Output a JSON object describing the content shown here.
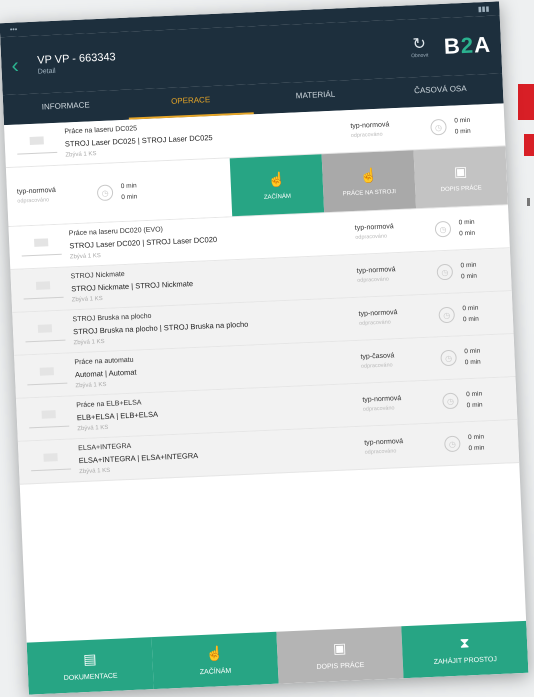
{
  "header": {
    "title": "VP VP - 663343",
    "subtitle": "Detail",
    "sync_label": "Obnovit",
    "logo_b": "B",
    "logo_2": "2",
    "logo_a": "A"
  },
  "tabs": [
    {
      "label": "INFORMACE"
    },
    {
      "label": "OPERACE"
    },
    {
      "label": "MATERIÁL"
    },
    {
      "label": "ČASOVÁ OSA"
    }
  ],
  "operations": [
    {
      "name": "Práce na laseru DC025",
      "desc": "STROJ Laser DC025 | STROJ Laser DC025",
      "qty": "Zbývá 1 KS",
      "norm": "typ-normová",
      "norm_sub": "odpracováno",
      "t1": "0 min",
      "t2": "0 min"
    },
    {
      "name": "Práce na laseru DC020 (EVO)",
      "desc": "STROJ Laser DC020 | STROJ Laser DC020",
      "qty": "Zbývá 1 KS",
      "norm": "typ-normová",
      "norm_sub": "odpracováno",
      "t1": "0 min",
      "t2": "0 min"
    },
    {
      "name": "STROJ Nickmate",
      "desc": "STROJ Nickmate | STROJ Nickmate",
      "qty": "Zbývá 1 KS",
      "norm": "typ-normová",
      "norm_sub": "odpracováno",
      "t1": "0 min",
      "t2": "0 min"
    },
    {
      "name": "STROJ Bruska na plocho",
      "desc": "STROJ Bruska na plocho | STROJ Bruska na plocho",
      "qty": "Zbývá 1 KS",
      "norm": "typ-normová",
      "norm_sub": "odpracováno",
      "t1": "0 min",
      "t2": "0 min"
    },
    {
      "name": "Práce na automatu",
      "desc": "Automat | Automat",
      "qty": "Zbývá 1 KS",
      "norm": "typ-časová",
      "norm_sub": "odpracováno",
      "t1": "0 min",
      "t2": "0 min"
    },
    {
      "name": "Práce na ELB+ELSA",
      "desc": "ELB+ELSA | ELB+ELSA",
      "qty": "Zbývá 1 KS",
      "norm": "typ-normová",
      "norm_sub": "odpracováno",
      "t1": "0 min",
      "t2": "0 min"
    },
    {
      "name": "ELSA+INTEGRA",
      "desc": "ELSA+INTEGRA | ELSA+INTEGRA",
      "qty": "Zbývá 1 KS",
      "norm": "typ-normová",
      "norm_sub": "odpracováno",
      "t1": "0 min",
      "t2": "0 min"
    }
  ],
  "action_row": {
    "norm": "typ-normová",
    "norm_sub": "odpracováno",
    "t1": "0 min",
    "t2": "0 min",
    "btn_start": "ZAČÍNÁM",
    "btn_machine": "PRÁCE NA STROJI",
    "btn_done": "DOPIS PRÁCE"
  },
  "footer": [
    {
      "label": "DOKUMENTACE"
    },
    {
      "label": "ZAČÍNÁM"
    },
    {
      "label": "DOPIS PRÁCE"
    },
    {
      "label": "ZAHÁJIT PROSTOJ"
    }
  ]
}
